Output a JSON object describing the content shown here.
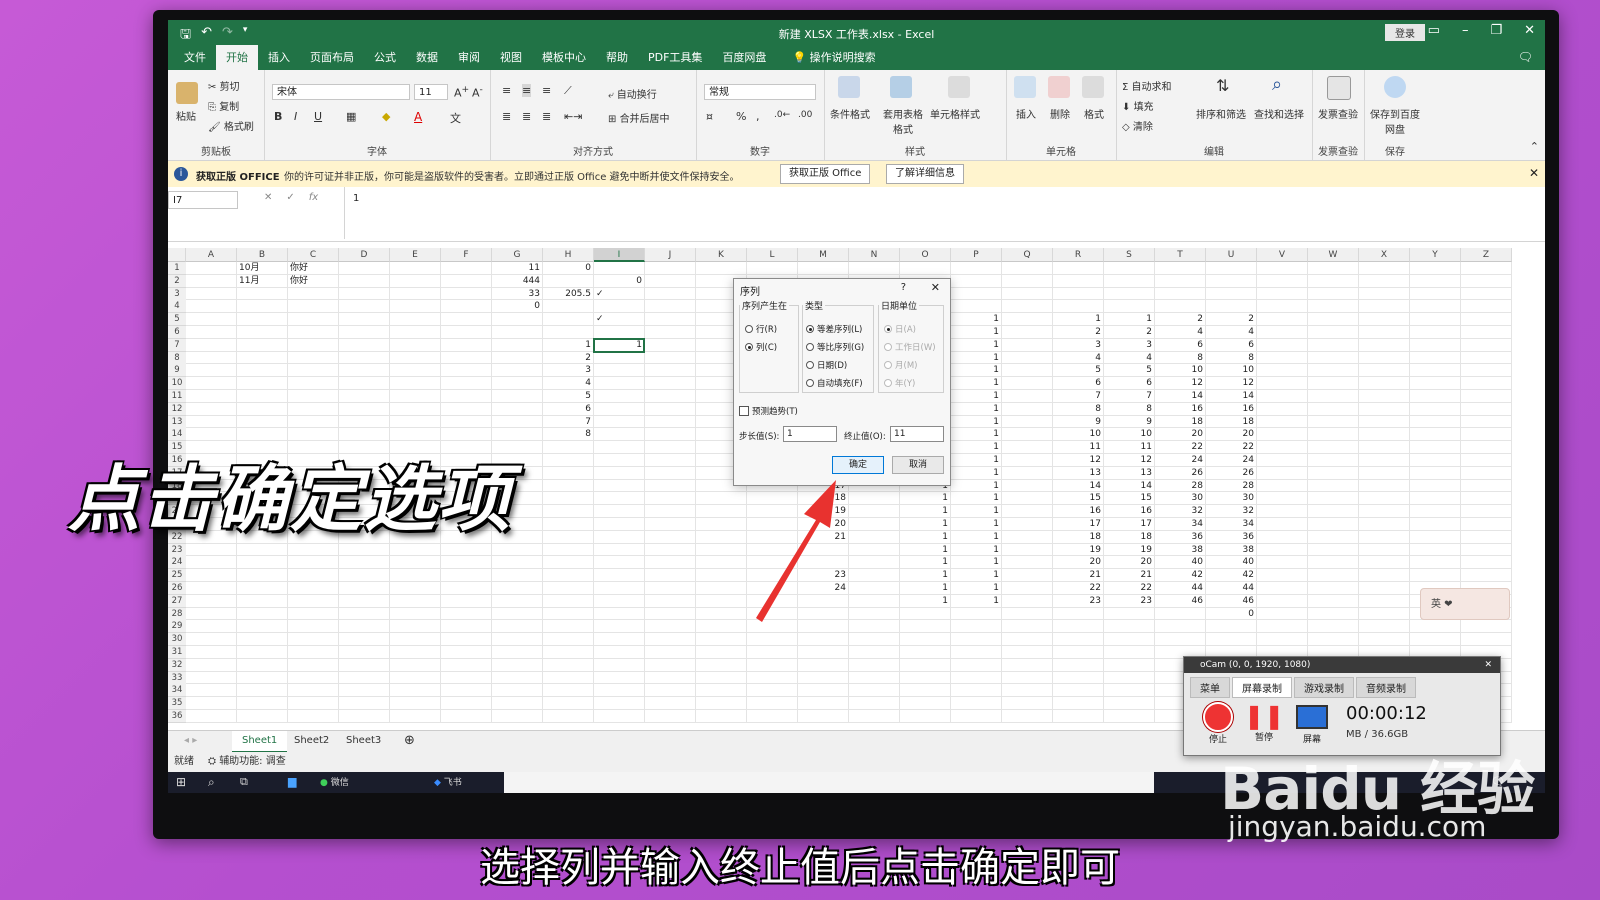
{
  "window": {
    "title": "新建 XLSX 工作表.xlsx - Excel",
    "login": "登录"
  },
  "tabs": [
    "文件",
    "开始",
    "插入",
    "页面布局",
    "公式",
    "数据",
    "审阅",
    "视图",
    "模板中心",
    "帮助",
    "PDF工具集",
    "百度网盘"
  ],
  "active_tab": "开始",
  "tell_me": "操作说明搜索",
  "ribbon": {
    "clipboard": {
      "label": "剪贴板",
      "paste": "粘贴",
      "cut": "剪切",
      "copy": "复制",
      "format_painter": "格式刷"
    },
    "font": {
      "label": "字体",
      "name": "宋体",
      "size": "11"
    },
    "alignment": {
      "label": "对齐方式",
      "wrap": "自动换行",
      "merge": "合并后居中"
    },
    "number": {
      "label": "数字",
      "format": "常规"
    },
    "styles": {
      "label": "样式",
      "conditional": "条件格式",
      "table": "套用表格格式",
      "cell_styles": "单元格样式"
    },
    "cells": {
      "label": "单元格",
      "insert": "插入",
      "delete": "删除",
      "format": "格式"
    },
    "editing": {
      "label": "编辑",
      "autosum": "自动求和",
      "fill": "填充",
      "clear": "清除",
      "sort": "排序和筛选",
      "find": "查找和选择"
    },
    "invoice": {
      "label": "发票查验",
      "btn": "发票查验"
    },
    "save": {
      "label": "保存",
      "btn": "保存到百度网盘"
    }
  },
  "infobar": {
    "bold": "获取正版 OFFICE",
    "message": "你的许可证并非正版，你可能是盗版软件的受害者。立即通过正版 Office 避免中断并使文件保持安全。",
    "btn1": "获取正版 Office",
    "btn2": "了解详细信息"
  },
  "formula": {
    "namebox": "I7",
    "value": "1"
  },
  "columns": [
    "A",
    "B",
    "C",
    "D",
    "E",
    "F",
    "G",
    "H",
    "I",
    "J",
    "K",
    "L",
    "M",
    "N",
    "O",
    "P",
    "Q",
    "R",
    "S",
    "T",
    "U",
    "V",
    "W",
    "X",
    "Y",
    "Z"
  ],
  "cells": [
    {
      "c": "B",
      "r": 1,
      "v": "10月",
      "a": "l"
    },
    {
      "c": "C",
      "r": 1,
      "v": "你好",
      "a": "l"
    },
    {
      "c": "G",
      "r": 1,
      "v": "11"
    },
    {
      "c": "H",
      "r": 1,
      "v": "0"
    },
    {
      "c": "B",
      "r": 2,
      "v": "11月",
      "a": "l"
    },
    {
      "c": "C",
      "r": 2,
      "v": "你好",
      "a": "l"
    },
    {
      "c": "G",
      "r": 2,
      "v": "444"
    },
    {
      "c": "I",
      "r": 2,
      "v": "0"
    },
    {
      "c": "G",
      "r": 3,
      "v": "33"
    },
    {
      "c": "H",
      "r": 3,
      "v": "205.5"
    },
    {
      "c": "I",
      "r": 3,
      "v": "✓",
      "a": "l"
    },
    {
      "c": "G",
      "r": 4,
      "v": "0"
    },
    {
      "c": "I",
      "r": 5,
      "v": "✓",
      "a": "l"
    },
    {
      "c": "H",
      "r": 7,
      "v": "1"
    },
    {
      "c": "I",
      "r": 7,
      "v": "1"
    },
    {
      "c": "H",
      "r": 8,
      "v": "2"
    },
    {
      "c": "H",
      "r": 9,
      "v": "3"
    },
    {
      "c": "H",
      "r": 10,
      "v": "4"
    },
    {
      "c": "H",
      "r": 11,
      "v": "5"
    },
    {
      "c": "H",
      "r": 12,
      "v": "6"
    },
    {
      "c": "H",
      "r": 13,
      "v": "7"
    },
    {
      "c": "H",
      "r": 14,
      "v": "8"
    },
    {
      "c": "M",
      "r": 16,
      "v": "15"
    },
    {
      "c": "M",
      "r": 17,
      "v": "16"
    },
    {
      "c": "M",
      "r": 18,
      "v": "17"
    },
    {
      "c": "M",
      "r": 19,
      "v": "18"
    },
    {
      "c": "M",
      "r": 20,
      "v": "19"
    },
    {
      "c": "M",
      "r": 21,
      "v": "20"
    },
    {
      "c": "M",
      "r": 22,
      "v": "21"
    },
    {
      "c": "M",
      "r": 25,
      "v": "23"
    },
    {
      "c": "M",
      "r": 26,
      "v": "24"
    },
    {
      "c": "U",
      "r": 28,
      "v": "0"
    }
  ],
  "series_block": {
    "O_from_row": 16,
    "O_to_row": 27,
    "P_from_row": 5,
    "P_to_row": 27,
    "R_start": 1,
    "S_start": 1,
    "T_start": 2,
    "first_row": 5,
    "last_row": 27
  },
  "row_count": 36,
  "dialog": {
    "title": "序列",
    "q": "?",
    "series_in_label": "序列产生在",
    "row": "行(R)",
    "column": "列(C)",
    "type_label": "类型",
    "linear": "等差序列(L)",
    "growth": "等比序列(G)",
    "date": "日期(D)",
    "autofill": "自动填充(F)",
    "date_unit_label": "日期单位",
    "day": "日(A)",
    "weekday": "工作日(W)",
    "month": "月(M)",
    "year": "年(Y)",
    "trend": "预测趋势(T)",
    "step_label": "步长值(S):",
    "step_value": "1",
    "stop_label": "终止值(O):",
    "stop_value": "11",
    "ok": "确定",
    "cancel": "取消"
  },
  "sheets": [
    "Sheet1",
    "Sheet2",
    "Sheet3"
  ],
  "status": {
    "ready": "就绪",
    "accessibility": "辅助功能: 调查"
  },
  "taskbar": {
    "wechat": "微信",
    "feishu": "飞书"
  },
  "ocam": {
    "title": "oCam (0, 0, 1920, 1080)",
    "tabs": [
      "菜单",
      "屏幕录制",
      "游戏录制",
      "音频录制"
    ],
    "stop": "停止",
    "pause": "暂停",
    "screen": "屏幕",
    "timer": "00:00:12",
    "size": "MB / 36.6GB"
  },
  "overlay": {
    "big_caption": "点击确定选项",
    "subtitle": "选择列并输入终止值后点击确定即可",
    "watermark": "Baidu 经验",
    "watermark_sub": "jingyan.baidu.com",
    "deco": "英 ❤"
  },
  "colors": {
    "excel_green": "#217346",
    "arrow": "#e8322f",
    "info_bg": "#fff4ce"
  }
}
